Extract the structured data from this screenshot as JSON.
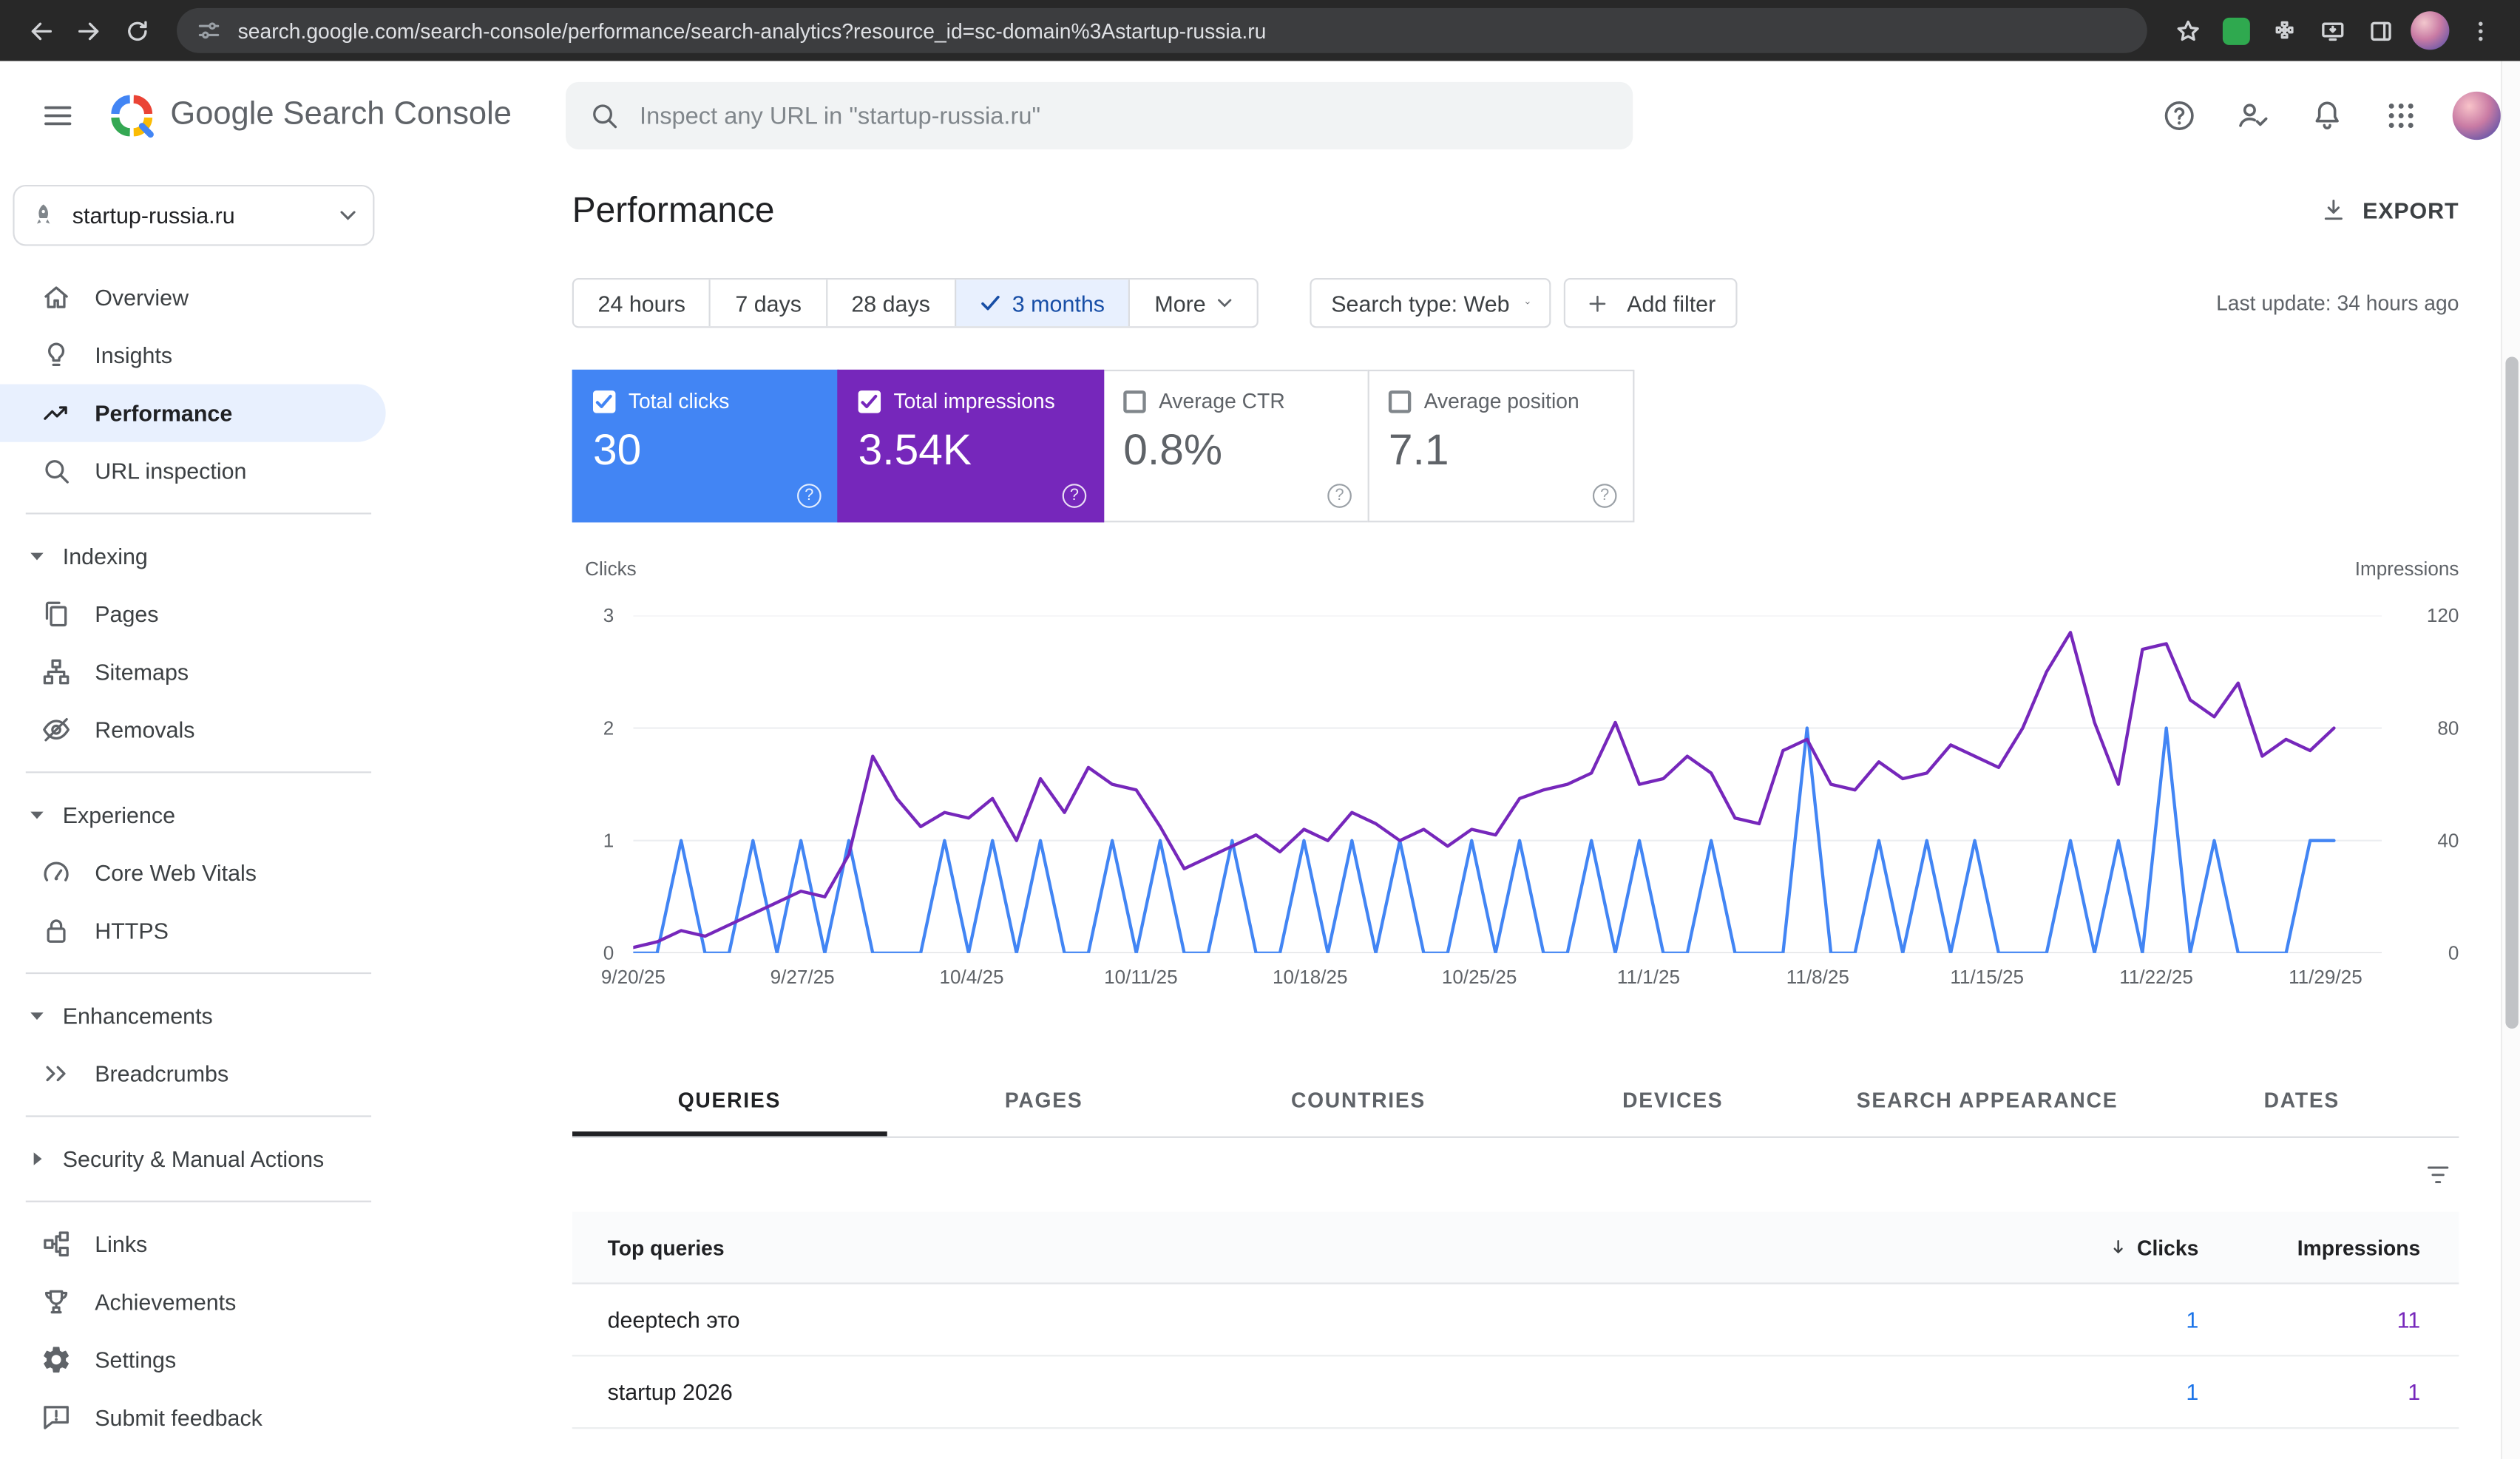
{
  "colors": {
    "clicks_blue": "#4285f4",
    "impressions_purple": "#7627bb",
    "selected_chip_bg": "#e8f0fe",
    "selected_chip_text": "#174ea6",
    "sidebar_selected_bg": "#e8f0fe",
    "link_blue": "#1a73e8"
  },
  "icons": {
    "back": "left-arrow",
    "forward": "right-arrow",
    "reload": "circular-arrow",
    "site_info": "tune-sliders",
    "bookmark": "star-outline",
    "extensions": "puzzle-piece",
    "menu": "kebab-dots",
    "hamburger": "three-lines",
    "search": "magnifier",
    "help": "question-circle",
    "notifications": "bell",
    "apps": "3x3-dot-grid",
    "export": "download-arrow",
    "table_filter": "funnel-lines",
    "sort": "down-arrow",
    "dropdown": "caret-down",
    "checkbox_checked": "white-box-check",
    "checkbox_unchecked": "gray-outline-box"
  },
  "browser": {
    "url": "search.google.com/search-console/performance/search-analytics?resource_id=sc-domain%3Astartup-russia.ru"
  },
  "app_bar": {
    "product_title": "Google Search Console",
    "search_placeholder": "Inspect any URL in \"startup-russia.ru\""
  },
  "sidebar": {
    "property_label": "startup-russia.ru",
    "overview": "Overview",
    "insights": "Insights",
    "performance": "Performance",
    "url_inspection": "URL inspection",
    "indexing_header": "Indexing",
    "pages": "Pages",
    "sitemaps": "Sitemaps",
    "removals": "Removals",
    "experience_header": "Experience",
    "core_web_vitals": "Core Web Vitals",
    "https": "HTTPS",
    "enhancements_header": "Enhancements",
    "breadcrumbs": "Breadcrumbs",
    "security_header": "Security & Manual Actions",
    "links": "Links",
    "achievements": "Achievements",
    "settings": "Settings",
    "submit_feedback": "Submit feedback"
  },
  "page": {
    "title": "Performance",
    "export_label": "EXPORT",
    "last_update": "Last update: 34 hours ago"
  },
  "filters": {
    "ranges": [
      "24 hours",
      "7 days",
      "28 days",
      "3 months",
      "More"
    ],
    "selected_range": "3 months",
    "search_type": "Search type: Web",
    "add_filter": "Add filter"
  },
  "metrics": {
    "cards": [
      {
        "label": "Total clicks",
        "value": "30",
        "selected": true
      },
      {
        "label": "Total impressions",
        "value": "3.54K",
        "selected": true
      },
      {
        "label": "Average CTR",
        "value": "0.8%",
        "selected": false
      },
      {
        "label": "Average position",
        "value": "7.1",
        "selected": false
      }
    ]
  },
  "tabs": {
    "items": [
      "QUERIES",
      "PAGES",
      "COUNTRIES",
      "DEVICES",
      "SEARCH APPEARANCE",
      "DATES"
    ],
    "active": "QUERIES"
  },
  "table": {
    "first_col_header": "Top queries",
    "clicks_header": "Clicks",
    "impressions_header": "Impressions",
    "rows": [
      {
        "query": "deeptech это",
        "clicks": "1",
        "impressions": "11"
      },
      {
        "query": "startup 2026",
        "clicks": "1",
        "impressions": "1"
      }
    ]
  },
  "chart_data": {
    "type": "line",
    "title": "Clicks and impressions over time (3 months, daily)",
    "x_start": "9/20/25",
    "x_end": "11/30/25",
    "x_tick_labels": [
      "9/20/25",
      "9/27/25",
      "10/4/25",
      "10/11/25",
      "10/18/25",
      "10/25/25",
      "11/1/25",
      "11/8/25",
      "11/15/25",
      "11/22/25",
      "11/29/25"
    ],
    "x_tick_interval_days": 7,
    "left_axis": {
      "label": "Clicks",
      "ticks": [
        "3",
        "2",
        "1",
        "0"
      ],
      "max": 3
    },
    "right_axis": {
      "label": "Impressions",
      "ticks": [
        "120",
        "80",
        "40",
        "0"
      ],
      "max": 120
    },
    "grid": true,
    "legend_position": "none",
    "series": [
      {
        "name": "Total clicks",
        "axis": "left",
        "color": "#4285f4",
        "values": [
          0,
          0,
          1,
          0,
          0,
          1,
          0,
          1,
          0,
          1,
          0,
          0,
          0,
          1,
          0,
          1,
          0,
          1,
          0,
          0,
          1,
          0,
          1,
          0,
          0,
          1,
          0,
          0,
          1,
          0,
          1,
          0,
          1,
          0,
          0,
          1,
          0,
          1,
          0,
          0,
          1,
          0,
          1,
          0,
          0,
          1,
          0,
          0,
          0,
          2,
          0,
          0,
          1,
          0,
          1,
          0,
          1,
          0,
          0,
          0,
          1,
          0,
          1,
          0,
          2,
          0,
          1,
          0,
          0,
          0,
          1,
          1
        ]
      },
      {
        "name": "Total impressions",
        "axis": "right",
        "color": "#7627bb",
        "values": [
          2,
          4,
          8,
          6,
          10,
          14,
          18,
          22,
          20,
          35,
          70,
          55,
          45,
          50,
          48,
          55,
          40,
          62,
          50,
          66,
          60,
          58,
          45,
          30,
          34,
          38,
          42,
          36,
          44,
          40,
          50,
          46,
          40,
          44,
          38,
          44,
          42,
          55,
          58,
          60,
          64,
          82,
          60,
          62,
          70,
          64,
          48,
          46,
          72,
          76,
          60,
          58,
          68,
          62,
          64,
          74,
          70,
          66,
          80,
          100,
          114,
          82,
          60,
          108,
          110,
          90,
          84,
          96,
          70,
          76,
          72,
          80
        ]
      }
    ]
  }
}
